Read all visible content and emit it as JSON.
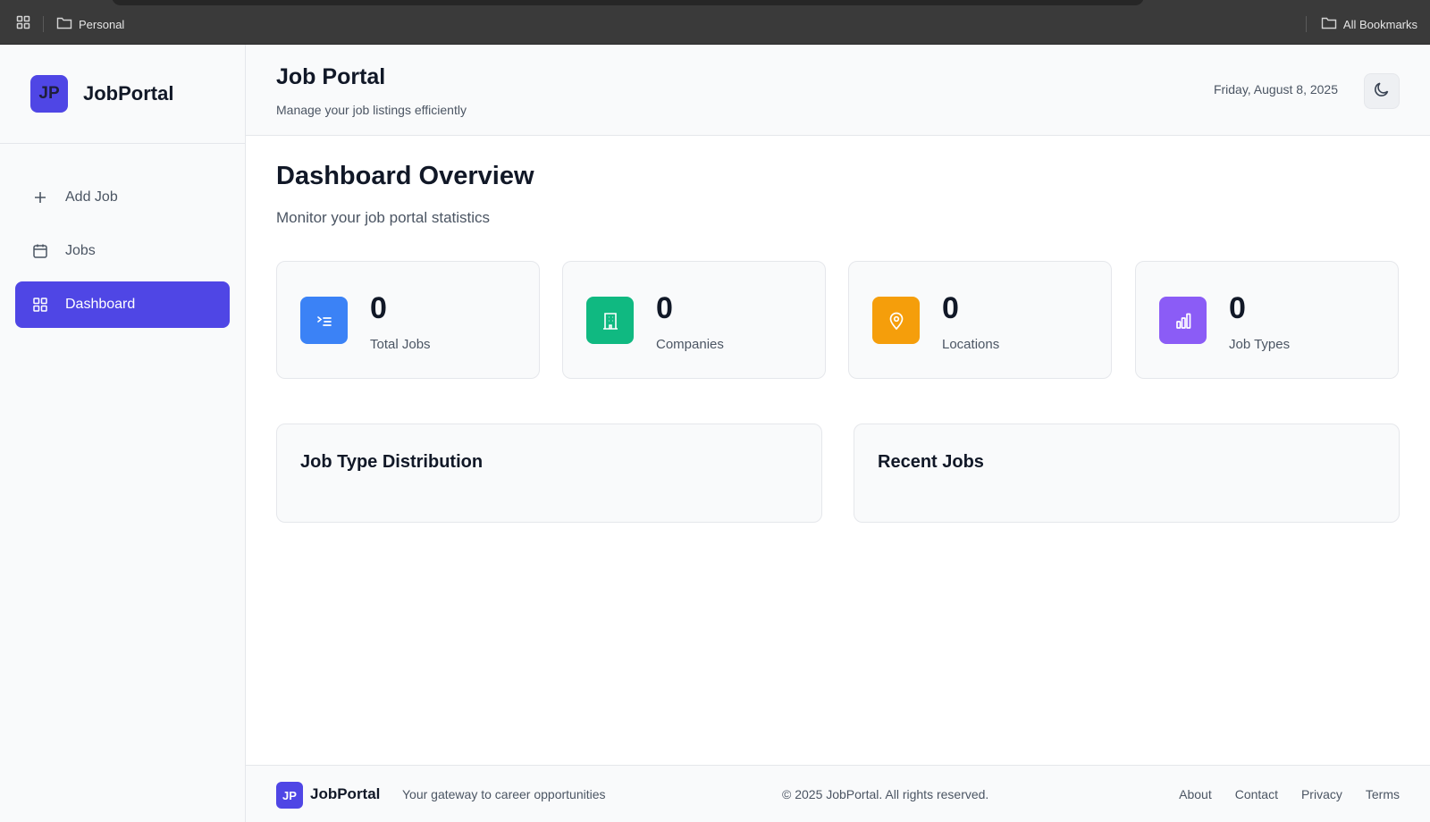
{
  "browser": {
    "bookmarks": [
      {
        "label": "Personal",
        "icon": "folder-icon"
      }
    ],
    "all_bookmarks_label": "All Bookmarks"
  },
  "sidebar": {
    "logo_text": "JP",
    "brand": "JobPortal",
    "items": [
      {
        "label": "Add Job",
        "icon": "plus-icon",
        "active": false
      },
      {
        "label": "Jobs",
        "icon": "calendar-icon",
        "active": false
      },
      {
        "label": "Dashboard",
        "icon": "grid-icon",
        "active": true
      }
    ]
  },
  "header": {
    "title": "Job Portal",
    "subtitle": "Manage your job listings efficiently",
    "date": "Friday, August 8, 2025",
    "theme_toggle_icon": "moon-icon"
  },
  "dashboard": {
    "title": "Dashboard Overview",
    "subtitle": "Monitor your job portal statistics",
    "stats": [
      {
        "value": "0",
        "label": "Total Jobs",
        "icon": "list-icon",
        "color": "#3b82f6"
      },
      {
        "value": "0",
        "label": "Companies",
        "icon": "building-icon",
        "color": "#10b981"
      },
      {
        "value": "0",
        "label": "Locations",
        "icon": "map-pin-icon",
        "color": "#f59e0b"
      },
      {
        "value": "0",
        "label": "Job Types",
        "icon": "bar-chart-icon",
        "color": "#8b5cf6"
      }
    ],
    "panels": [
      {
        "title": "Job Type Distribution"
      },
      {
        "title": "Recent Jobs"
      }
    ]
  },
  "footer": {
    "logo_text": "JP",
    "brand": "JobPortal",
    "tagline": "Your gateway to career opportunities",
    "copyright": "© 2025 JobPortal. All rights reserved.",
    "links": [
      "About",
      "Contact",
      "Privacy",
      "Terms"
    ]
  },
  "colors": {
    "accent": "#4f46e5"
  }
}
